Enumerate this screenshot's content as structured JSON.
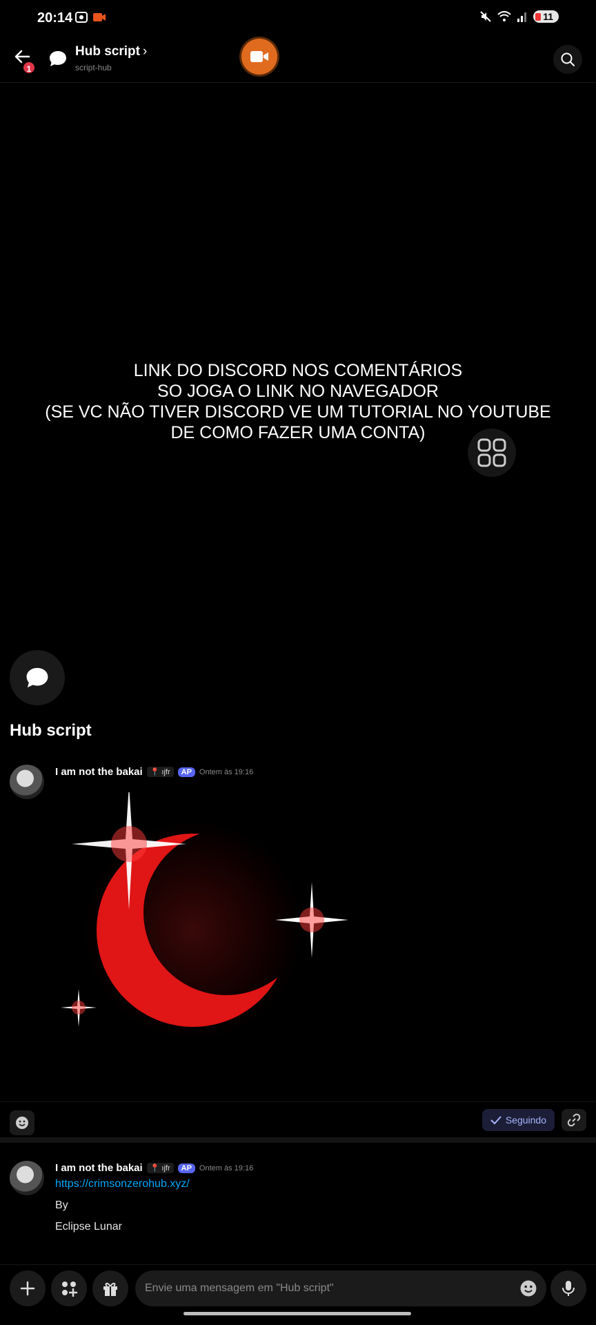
{
  "status_bar": {
    "time": "20:14",
    "battery": "11"
  },
  "header": {
    "notification_count": "1",
    "channel_title": "Hub script",
    "channel_subtitle": "script-hub"
  },
  "overlay": {
    "lines": [
      "LINK DO DISCORD NOS COMENTÁRIOS",
      "SO JOGA O LINK NO NAVEGADOR",
      "(SE VC NÃO TIVER DISCORD VE UM TUTORIAL NO YOUTUBE",
      "DE COMO FAZER UMA CONTA)"
    ]
  },
  "thread": {
    "title": "Hub script"
  },
  "messages": [
    {
      "author": "I am not the bakai",
      "tag": "ıjfr",
      "badge": "AP",
      "timestamp": "Ontem às 19:16"
    },
    {
      "author": "I am not the bakai",
      "tag": "ıjfr",
      "badge": "AP",
      "timestamp": "Ontem às 19:16",
      "link": "https://crimsonzerohub.xyz/",
      "lines": [
        "By",
        "Eclipse Lunar"
      ]
    }
  ],
  "actions": {
    "following_label": "Seguindo"
  },
  "composer": {
    "placeholder": "Envie uma mensagem em \"Hub script\""
  },
  "icons": [
    "back-arrow-icon",
    "chat-bubble-icon",
    "video-camera-icon",
    "search-icon",
    "grid-icon",
    "emoji-icon",
    "check-icon",
    "link-icon",
    "plus-icon",
    "apps-icon",
    "gift-icon",
    "microphone-icon"
  ],
  "colors": {
    "accent": "#5865f2",
    "link": "#00a8fc",
    "video": "#e06b1e",
    "badge": "#e0364a"
  }
}
